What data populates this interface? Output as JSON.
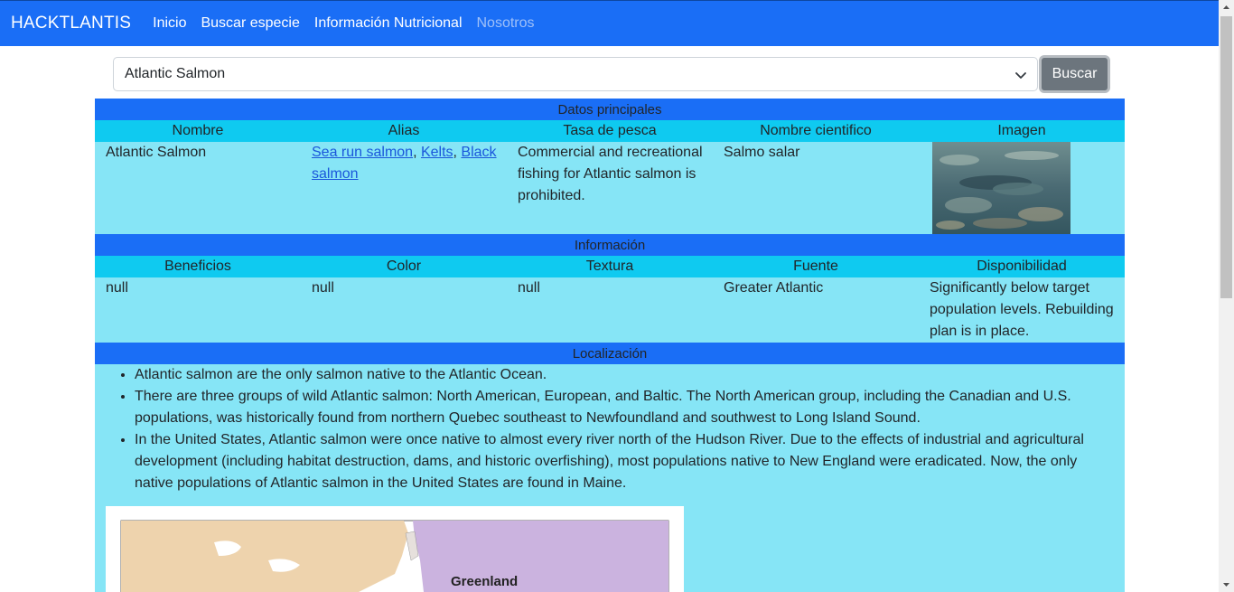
{
  "navbar": {
    "brand": "HACKTLANTIS",
    "links": [
      "Inicio",
      "Buscar especie",
      "Información Nutricional",
      "Nosotros"
    ]
  },
  "search": {
    "selected": "Atlantic Salmon",
    "button": "Buscar"
  },
  "principal": {
    "header": "Datos principales",
    "columns": [
      "Nombre",
      "Alias",
      "Tasa de pesca",
      "Nombre cientifico",
      "Imagen"
    ],
    "nombre": "Atlantic Salmon",
    "alias": [
      "Sea run salmon",
      "Kelts",
      "Black salmon"
    ],
    "tasa": "Commercial and recreational fishing for Atlantic salmon is prohibited.",
    "cientifico": "Salmo salar"
  },
  "informacion": {
    "header": "Información",
    "columns": [
      "Beneficios",
      "Color",
      "Textura",
      "Fuente",
      "Disponibilidad"
    ],
    "beneficios": "null",
    "color": "null",
    "textura": "null",
    "fuente": "Greater Atlantic",
    "disponibilidad": "Significantly below target population levels. Rebuilding plan is in place."
  },
  "localizacion": {
    "header": "Localización",
    "items": [
      "Atlantic salmon are the only salmon native to the Atlantic Ocean.",
      "There are three groups of wild Atlantic salmon: North American, European, and Baltic. The North American group, including the Canadian and U.S. populations, was historically found from northern Quebec southeast to Newfoundland and southwest to Long Island Sound.",
      "In the United States, Atlantic salmon were once native to almost every river north of the Hudson River. Due to the effects of industrial and agricultural development (including habitat destruction, dams, and historic overfishing), most populations native to New England were eradicated. Now, the only native populations of Atlantic salmon in the United States are found in Maine."
    ],
    "map_label": "Greenland"
  },
  "colors": {
    "navbar": "#1a6ef6",
    "section_header": "#1a6ef6",
    "column_header": "#0fcaf0",
    "row": "#86e5f6",
    "button": "#6c757d"
  }
}
